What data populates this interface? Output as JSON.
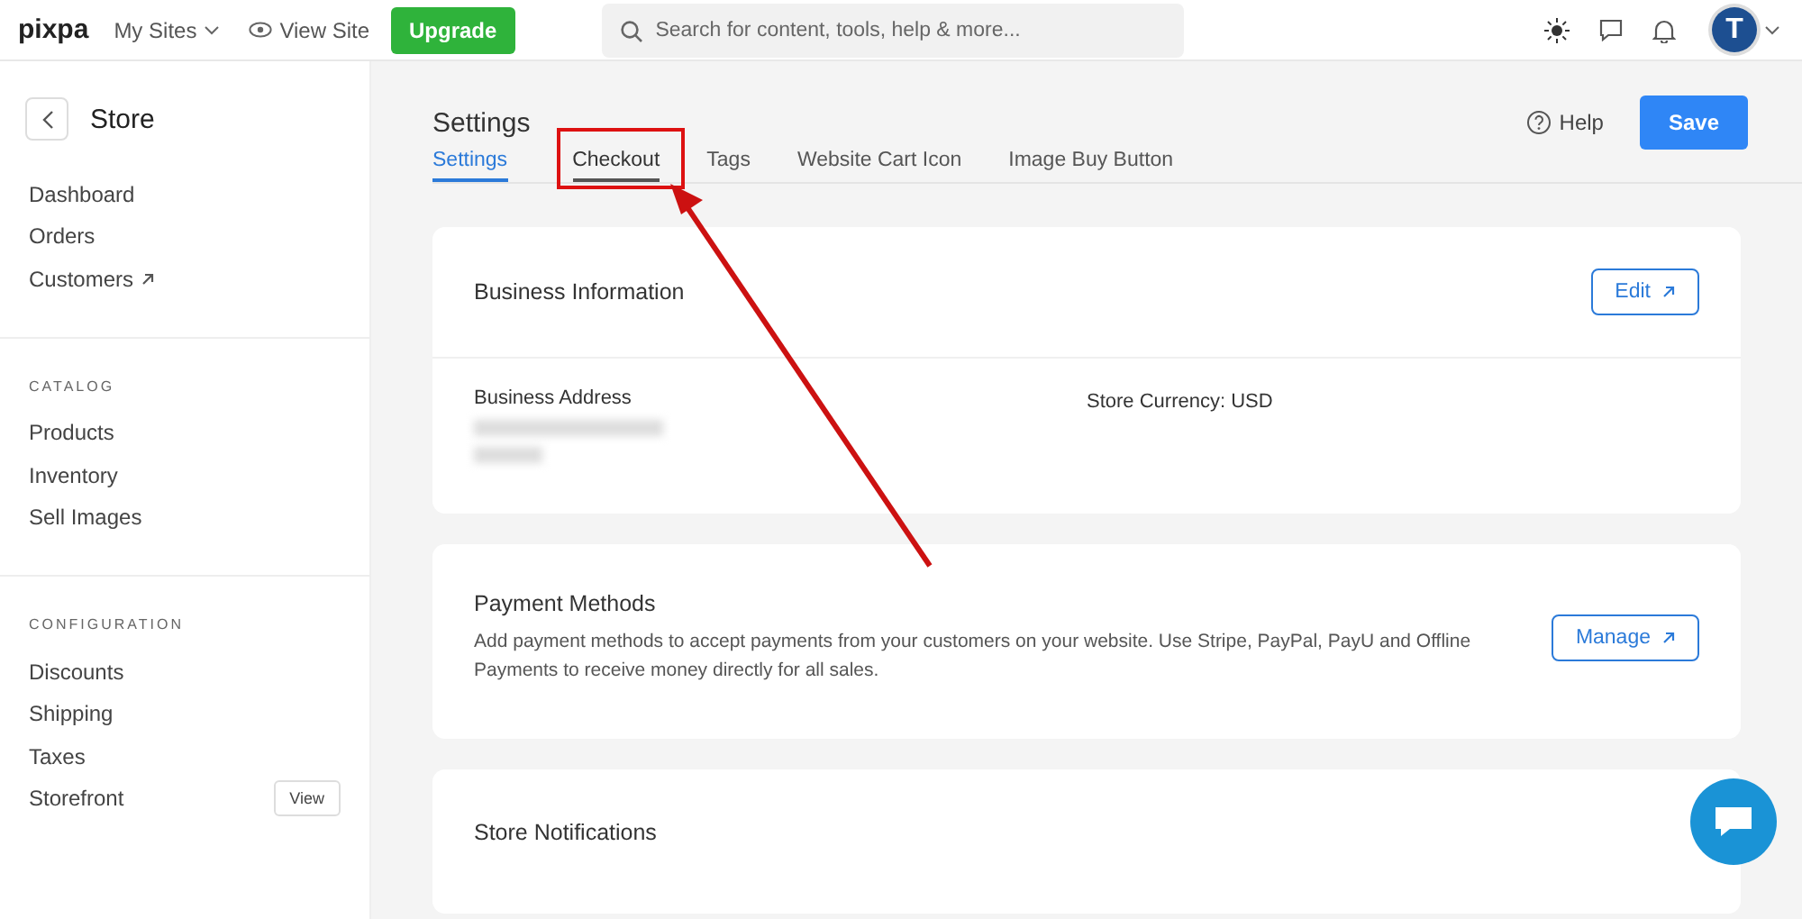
{
  "topbar": {
    "logo": "pixpa",
    "my_sites": "My Sites",
    "view_site": "View Site",
    "upgrade": "Upgrade",
    "search": {
      "placeholder": "Search for content, tools, help & more..."
    },
    "avatar_letter": "T"
  },
  "sidebar": {
    "title": "Store",
    "sections": [
      {
        "items": [
          {
            "label": "Dashboard",
            "external": false
          },
          {
            "label": "Orders",
            "external": false
          },
          {
            "label": "Customers",
            "external": true
          }
        ]
      },
      {
        "heading": "CATALOG",
        "items": [
          {
            "label": "Products",
            "external": false
          },
          {
            "label": "Inventory",
            "external": false
          },
          {
            "label": "Sell Images",
            "external": false
          }
        ]
      },
      {
        "heading": "CONFIGURATION",
        "items": [
          {
            "label": "Discounts",
            "external": false
          },
          {
            "label": "Shipping",
            "external": false
          },
          {
            "label": "Taxes",
            "external": false
          },
          {
            "label": "Storefront",
            "external": false,
            "action": "View"
          }
        ]
      }
    ]
  },
  "page": {
    "title": "Settings",
    "help": "Help",
    "save": "Save",
    "tabs": [
      {
        "label": "Settings",
        "selected": true,
        "highlighted": false
      },
      {
        "label": "Checkout",
        "selected": false,
        "highlighted": true
      },
      {
        "label": "Tags",
        "selected": false,
        "highlighted": false
      },
      {
        "label": "Website Cart Icon",
        "selected": false,
        "highlighted": false
      },
      {
        "label": "Image Buy Button",
        "selected": false,
        "highlighted": false
      }
    ],
    "business": {
      "title": "Business Information",
      "button": "Edit",
      "address_label": "Business Address",
      "currency": "Store Currency: USD"
    },
    "payment": {
      "title": "Payment Methods",
      "description": "Add payment methods to accept payments from your customers on your website. Use Stripe, PayPal, PayU and Offline Payments to receive money directly for all sales.",
      "button": "Manage"
    },
    "notifications": {
      "title": "Store Notifications"
    }
  }
}
